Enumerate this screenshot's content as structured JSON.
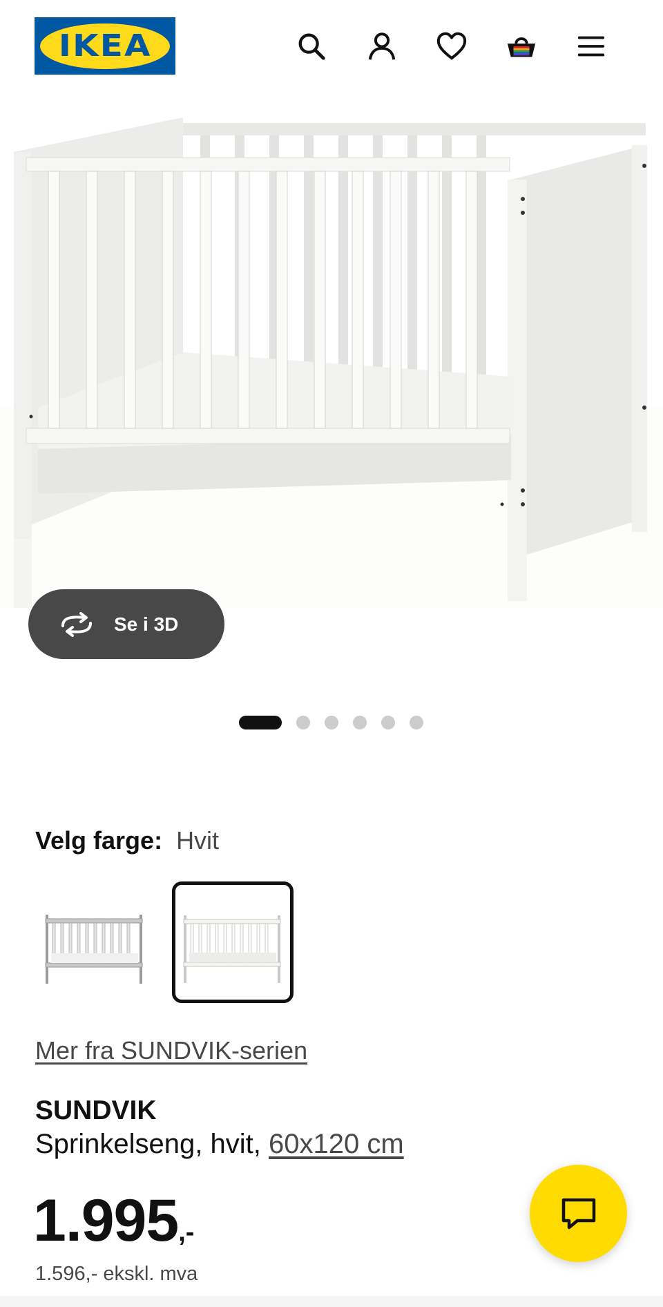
{
  "brand": {
    "logo_text": "IKEA",
    "colors": {
      "blue": "#0058a3",
      "yellow": "#ffda1a"
    }
  },
  "header": {
    "icons": [
      "search-icon",
      "user-icon",
      "heart-icon",
      "basket-icon",
      "menu-icon"
    ]
  },
  "gallery": {
    "view_3d_label": "Se i 3D",
    "slide_count": 6,
    "active_slide": 1
  },
  "color_picker": {
    "label": "Velg farge:",
    "selected_value": "Hvit",
    "options": [
      "grå",
      "hvit"
    ],
    "selected_index": 1
  },
  "series_link": "Mer fra SUNDVIK-serien",
  "product": {
    "name": "SUNDVIK",
    "description": "Sprinkelseng, hvit,",
    "size": "60x120 cm",
    "price": "1.995",
    "price_suffix": ",-",
    "price_ex_vat": "1.596,- ekskl. mva"
  },
  "chat": {
    "icon": "chat-bubble-icon",
    "color": "#ffdb00"
  }
}
